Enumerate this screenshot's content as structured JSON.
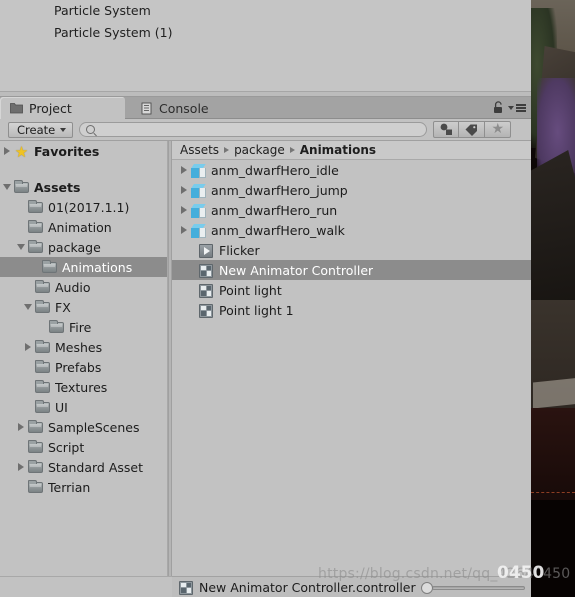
{
  "hierarchy": {
    "rows": [
      {
        "label": "Particle System"
      },
      {
        "label": "Particle System (1)"
      }
    ]
  },
  "tabs": [
    {
      "label": "Project",
      "icon": "folder-icon",
      "active": true
    },
    {
      "label": "Console",
      "icon": "console-icon",
      "active": false
    }
  ],
  "window_controls": {
    "lock": "lock-icon",
    "menu": "tab-menu-icon"
  },
  "toolbar": {
    "create_label": "Create",
    "search_value": "",
    "search_placeholder": "",
    "filters": [
      {
        "name": "type-filter-button",
        "icon": "shapes-icon"
      },
      {
        "name": "label-filter-button",
        "icon": "tag-icon"
      },
      {
        "name": "favorites-filter-button",
        "icon": "star-icon"
      }
    ]
  },
  "tree": {
    "items": [
      {
        "label": "Favorites",
        "depth": 0,
        "icon": "star-icon",
        "twisty": "right",
        "bold": true,
        "selected": false
      },
      {
        "label": "",
        "depth": 0,
        "icon": "none",
        "twisty": "none",
        "bold": false,
        "selected": false,
        "spacer": true
      },
      {
        "label": "Assets",
        "depth": 0,
        "icon": "folder-icon",
        "twisty": "down",
        "bold": true,
        "selected": false
      },
      {
        "label": "01(2017.1.1)",
        "depth": 1,
        "icon": "folder-icon",
        "twisty": "none",
        "bold": false,
        "selected": false
      },
      {
        "label": "Animation",
        "depth": 1,
        "icon": "folder-icon",
        "twisty": "none",
        "bold": false,
        "selected": false
      },
      {
        "label": "package",
        "depth": 1,
        "icon": "folder-icon",
        "twisty": "down",
        "bold": false,
        "selected": false
      },
      {
        "label": "Animations",
        "depth": 2,
        "icon": "folder-icon",
        "twisty": "none",
        "bold": false,
        "selected": true
      },
      {
        "label": "Audio",
        "depth": 1.5,
        "icon": "folder-icon",
        "twisty": "none",
        "bold": false,
        "selected": false
      },
      {
        "label": "FX",
        "depth": 1.5,
        "icon": "folder-icon",
        "twisty": "down",
        "bold": false,
        "selected": false
      },
      {
        "label": "Fire",
        "depth": 2.5,
        "icon": "folder-icon",
        "twisty": "none",
        "bold": false,
        "selected": false
      },
      {
        "label": "Meshes",
        "depth": 1.5,
        "icon": "folder-icon",
        "twisty": "right",
        "bold": false,
        "selected": false
      },
      {
        "label": "Prefabs",
        "depth": 1.5,
        "icon": "folder-icon",
        "twisty": "none",
        "bold": false,
        "selected": false
      },
      {
        "label": "Textures",
        "depth": 1.5,
        "icon": "folder-icon",
        "twisty": "none",
        "bold": false,
        "selected": false
      },
      {
        "label": "UI",
        "depth": 1.5,
        "icon": "folder-icon",
        "twisty": "none",
        "bold": false,
        "selected": false
      },
      {
        "label": "SampleScenes",
        "depth": 1,
        "icon": "folder-icon",
        "twisty": "right",
        "bold": false,
        "selected": false
      },
      {
        "label": "Script",
        "depth": 1,
        "icon": "folder-icon",
        "twisty": "none",
        "bold": false,
        "selected": false
      },
      {
        "label": "Standard Asset",
        "depth": 1,
        "icon": "folder-icon",
        "twisty": "right",
        "bold": false,
        "selected": false
      },
      {
        "label": "Terrian",
        "depth": 1,
        "icon": "folder-icon",
        "twisty": "none",
        "bold": false,
        "selected": false
      }
    ]
  },
  "breadcrumb": {
    "crumbs": [
      "Assets",
      "package",
      "Animations"
    ]
  },
  "assets": {
    "items": [
      {
        "label": "anm_dwarfHero_idle",
        "icon": "model-cube-icon",
        "twisty": "right",
        "selected": false
      },
      {
        "label": "anm_dwarfHero_jump",
        "icon": "model-cube-icon",
        "twisty": "right",
        "selected": false
      },
      {
        "label": "anm_dwarfHero_run",
        "icon": "model-cube-icon",
        "twisty": "right",
        "selected": false
      },
      {
        "label": "anm_dwarfHero_walk",
        "icon": "model-cube-icon",
        "twisty": "right",
        "selected": false
      },
      {
        "label": "Flicker",
        "icon": "animation-clip-icon",
        "twisty": "none",
        "selected": false
      },
      {
        "label": "New Animator Controller",
        "icon": "animator-controller-icon",
        "twisty": "none",
        "selected": true
      },
      {
        "label": "Point light",
        "icon": "animator-controller-icon",
        "twisty": "none",
        "selected": false
      },
      {
        "label": "Point light 1",
        "icon": "animator-controller-icon",
        "twisty": "none",
        "selected": false
      }
    ]
  },
  "statusbar": {
    "icon": "animator-controller-icon",
    "label": "New Animator Controller.controller",
    "zoom_value": 0
  },
  "watermark": {
    "url": "https://blog.csdn.net/qq_42640450",
    "suffix": "0450"
  },
  "colors": {
    "panel_bg": "#c2c2c2",
    "tabstrip_bg": "#a3a3a3",
    "selection": "#8c8c8c",
    "selection_text": "#ffffff",
    "favorites_star": "#f0c322",
    "model_cube": "#45aedb"
  }
}
